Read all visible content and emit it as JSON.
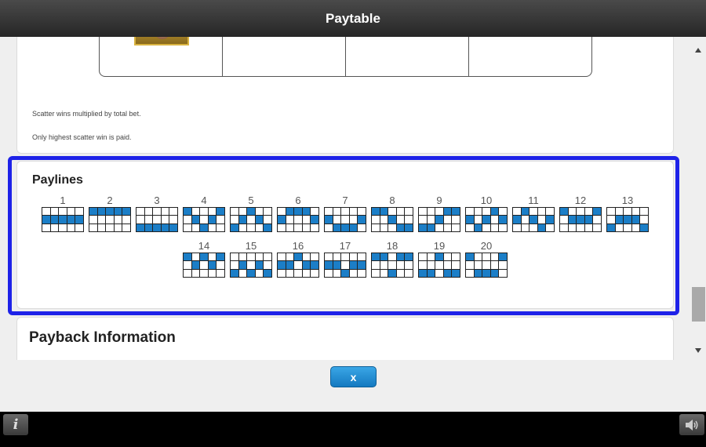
{
  "window": {
    "title": "Paytable"
  },
  "scatter": {
    "notes": [
      "Scatter wins multiplied by total bet.",
      "Only highest scatter win is paid."
    ]
  },
  "paylines": {
    "title": "Paylines",
    "lines": [
      {
        "number": "1",
        "rows": [
          1,
          1,
          1,
          1,
          1
        ]
      },
      {
        "number": "2",
        "rows": [
          0,
          0,
          0,
          0,
          0
        ]
      },
      {
        "number": "3",
        "rows": [
          2,
          2,
          2,
          2,
          2
        ]
      },
      {
        "number": "4",
        "rows": [
          0,
          1,
          2,
          1,
          0
        ]
      },
      {
        "number": "5",
        "rows": [
          2,
          1,
          0,
          1,
          2
        ]
      },
      {
        "number": "6",
        "rows": [
          1,
          0,
          0,
          0,
          1
        ]
      },
      {
        "number": "7",
        "rows": [
          1,
          2,
          2,
          2,
          1
        ]
      },
      {
        "number": "8",
        "rows": [
          0,
          0,
          1,
          2,
          2
        ]
      },
      {
        "number": "9",
        "rows": [
          2,
          2,
          1,
          0,
          0
        ]
      },
      {
        "number": "10",
        "rows": [
          1,
          2,
          1,
          0,
          1
        ]
      },
      {
        "number": "11",
        "rows": [
          1,
          0,
          1,
          2,
          1
        ]
      },
      {
        "number": "12",
        "rows": [
          0,
          1,
          1,
          1,
          0
        ]
      },
      {
        "number": "13",
        "rows": [
          2,
          1,
          1,
          1,
          2
        ]
      },
      {
        "number": "14",
        "rows": [
          0,
          1,
          0,
          1,
          0
        ]
      },
      {
        "number": "15",
        "rows": [
          2,
          1,
          2,
          1,
          2
        ]
      },
      {
        "number": "16",
        "rows": [
          1,
          1,
          0,
          1,
          1
        ]
      },
      {
        "number": "17",
        "rows": [
          1,
          1,
          2,
          1,
          1
        ]
      },
      {
        "number": "18",
        "rows": [
          0,
          0,
          2,
          0,
          0
        ]
      },
      {
        "number": "19",
        "rows": [
          2,
          2,
          0,
          2,
          2
        ]
      },
      {
        "number": "20",
        "rows": [
          0,
          2,
          2,
          2,
          0
        ]
      }
    ]
  },
  "payback": {
    "title": "Payback Information"
  },
  "close_button": {
    "label": "x"
  },
  "colors": {
    "payline_cell": "#1b7ec7",
    "highlight_border": "#1e22e8",
    "button": "#1f8fd6"
  },
  "icons": {
    "info": "info-icon",
    "sound": "speaker-icon",
    "scroll_up": "arrow-up-icon",
    "scroll_down": "arrow-down-icon"
  },
  "info_button": {
    "glyph": "i"
  }
}
